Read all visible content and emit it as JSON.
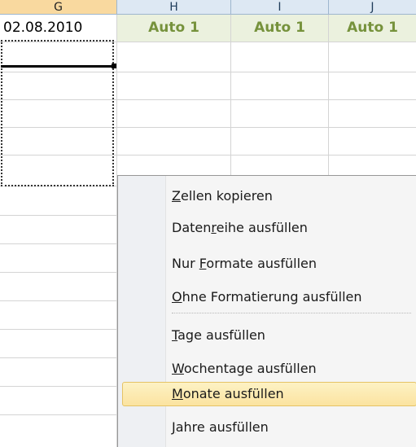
{
  "columns": {
    "g": "G",
    "h": "H",
    "i": "I",
    "j": "J"
  },
  "row1": {
    "g": "02.08.2010",
    "h": "Auto 1",
    "i": "Auto 1",
    "j": "Auto 1"
  },
  "menu": {
    "items": [
      {
        "pre": "",
        "key": "Z",
        "post": "ellen kopieren"
      },
      {
        "pre": "Daten",
        "key": "r",
        "post": "eihe ausfüllen"
      },
      {
        "pre": "Nur ",
        "key": "F",
        "post": "ormate ausfüllen"
      },
      {
        "pre": "",
        "key": "O",
        "post": "hne Formatierung ausfüllen"
      },
      {
        "pre": "",
        "key": "T",
        "post": "age ausfüllen"
      },
      {
        "pre": "",
        "key": "W",
        "post": "ochentage ausfüllen"
      },
      {
        "pre": "",
        "key": "M",
        "post": "onate ausfüllen"
      },
      {
        "pre": "",
        "key": "J",
        "post": "ahre ausfüllen"
      }
    ],
    "highlighted": "Monate ausfüllen"
  },
  "colors": {
    "header_bg": "#dde8f3",
    "selected_header_bg": "#f9d99f",
    "fill_cell_bg": "#ebf1de",
    "fill_text": "#76923c",
    "hover_bg": "#fbe3a0"
  }
}
